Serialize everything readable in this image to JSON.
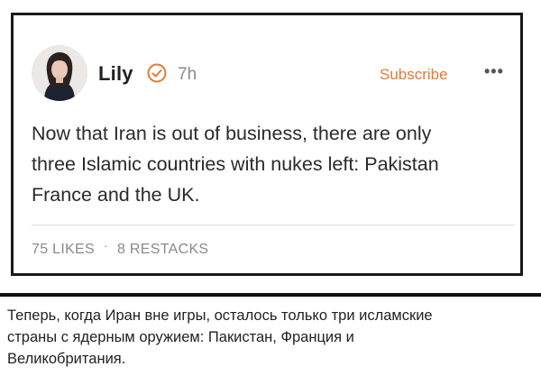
{
  "post": {
    "author": "Lily",
    "verified_icon": "check-circle-icon",
    "time": "7h",
    "subscribe_label": "Subscribe",
    "more_label": "•••",
    "body_lines": [
      "Now that Iran is out of business, there are only",
      "three Islamic countries with nukes left: Pakistan",
      "France and the UK."
    ],
    "likes": "75 LIKES",
    "separator": "·",
    "restacks": "8 RESTACKS"
  },
  "caption": {
    "lines": [
      "Теперь, когда Иран вне игры, осталось только три исламские",
      "страны с ядерным оружием: Пакистан, Франция и",
      "Великобритания."
    ]
  },
  "colors": {
    "accent": "#e07a3a",
    "text": "#2a2a2a",
    "muted": "#8a8a8a",
    "border": "#1a1a1a"
  }
}
